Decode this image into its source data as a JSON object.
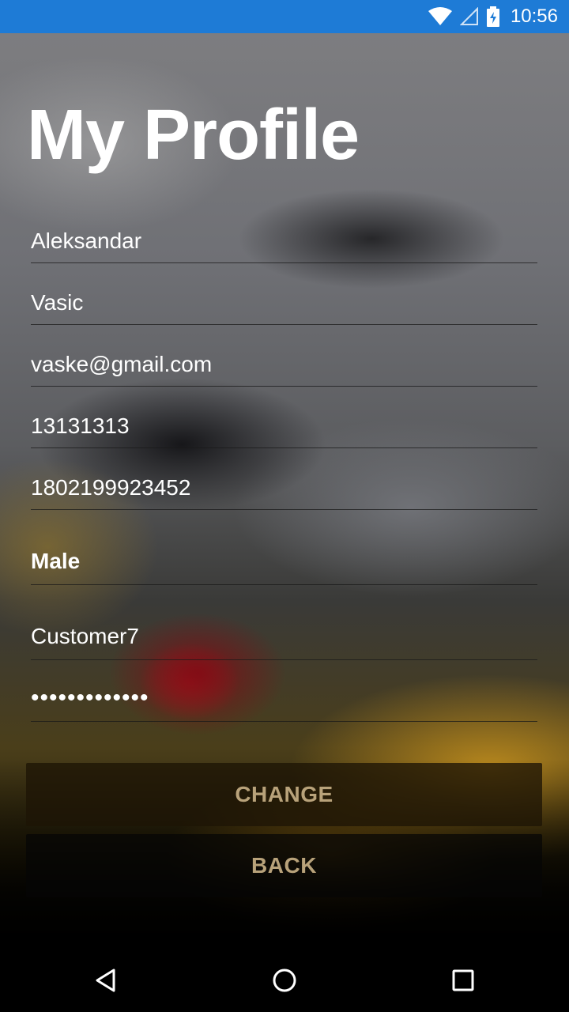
{
  "status_bar": {
    "time": "10:56",
    "icons": [
      "wifi-icon",
      "cellular-signal-icon",
      "battery-charging-icon"
    ]
  },
  "page": {
    "title": "My Profile"
  },
  "form": {
    "first_name": "Aleksandar",
    "last_name": "Vasic",
    "email": "vaske@gmail.com",
    "phone": "13131313",
    "jmbg": "1802199923452",
    "gender": "Male",
    "username": "Customer7",
    "password": "•••••••••••••"
  },
  "buttons": {
    "change": "CHANGE",
    "back": "BACK"
  },
  "nav_bar": {
    "icons": [
      "back-triangle-icon",
      "home-circle-icon",
      "recents-square-icon"
    ]
  },
  "colors": {
    "status_bar": "#1e7bd6",
    "button_text": "#b8a27a",
    "text": "#ffffff"
  }
}
